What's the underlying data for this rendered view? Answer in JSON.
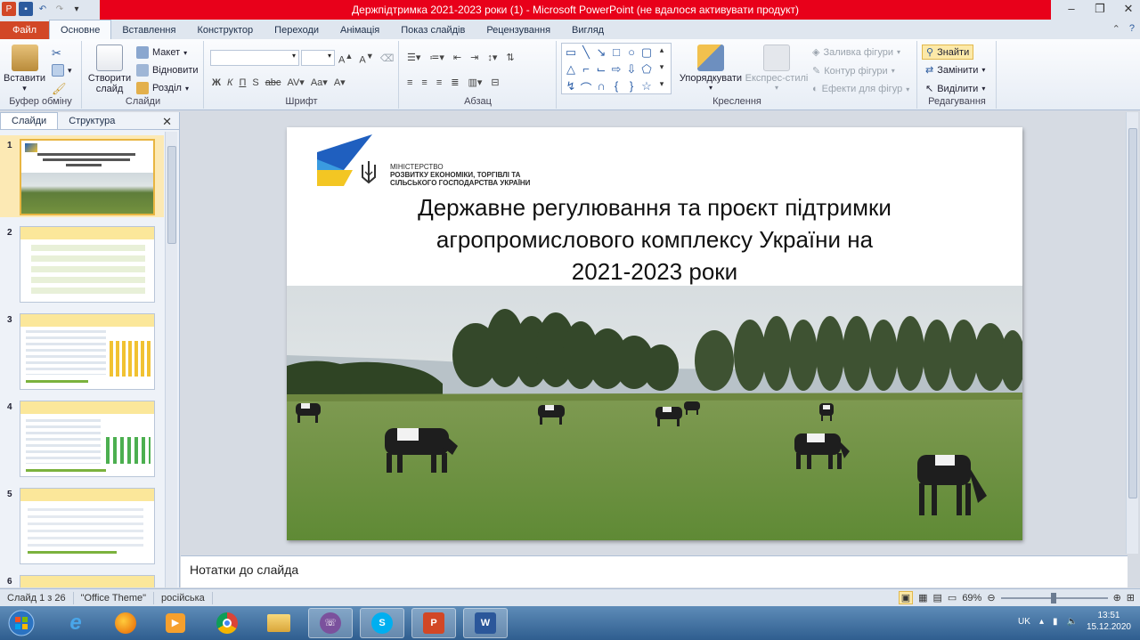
{
  "window": {
    "title": "Держпідтримка 2021-2023 роки (1)  -  Microsoft PowerPoint (не вдалося активувати продукт)"
  },
  "tabs": [
    "Файл",
    "Основне",
    "Вставлення",
    "Конструктор",
    "Переходи",
    "Анімація",
    "Показ слайдів",
    "Рецензування",
    "Вигляд"
  ],
  "ribbon": {
    "clipboard": {
      "paste": "Вставити",
      "label": "Буфер обміну"
    },
    "slides": {
      "new_slide": "Створити слайд",
      "layout": "Макет",
      "reset": "Відновити",
      "section": "Розділ",
      "label": "Слайди"
    },
    "font": {
      "label": "Шрифт"
    },
    "paragraph": {
      "label": "Абзац"
    },
    "drawing": {
      "arrange": "Упорядкувати",
      "quick_styles": "Експрес-стилі",
      "shape_fill": "Заливка фігури",
      "shape_outline": "Контур фігури",
      "shape_effects": "Ефекти для фігур",
      "label": "Креслення"
    },
    "editing": {
      "find": "Знайти",
      "replace": "Замінити",
      "select": "Виділити",
      "label": "Редагування"
    }
  },
  "left_pane": {
    "tab_slides": "Слайди",
    "tab_outline": "Структура",
    "slide_numbers": [
      "1",
      "2",
      "3",
      "4",
      "5",
      "6"
    ]
  },
  "slide": {
    "ministry_line1": "МІНІСТЕРСТВО",
    "ministry_line2": "РОЗВИТКУ ЕКОНОМІКИ, ТОРГІВЛІ ТА",
    "ministry_line3": "СІЛЬСЬКОГО ГОСПОДАРСТВА УКРАЇНИ",
    "title_line1": "Державне регулювання та проєкт підтримки",
    "title_line2": "агропромислового комплексу України на",
    "title_line3": "2021-2023 роки"
  },
  "notes_placeholder": "Нотатки до слайда",
  "status": {
    "slide_info": "Слайд 1 з 26",
    "theme": "\"Office Theme\"",
    "language": "російська",
    "zoom": "69%"
  },
  "taskbar": {
    "lang": "UK",
    "time": "13:51",
    "date": "15.12.2020"
  }
}
